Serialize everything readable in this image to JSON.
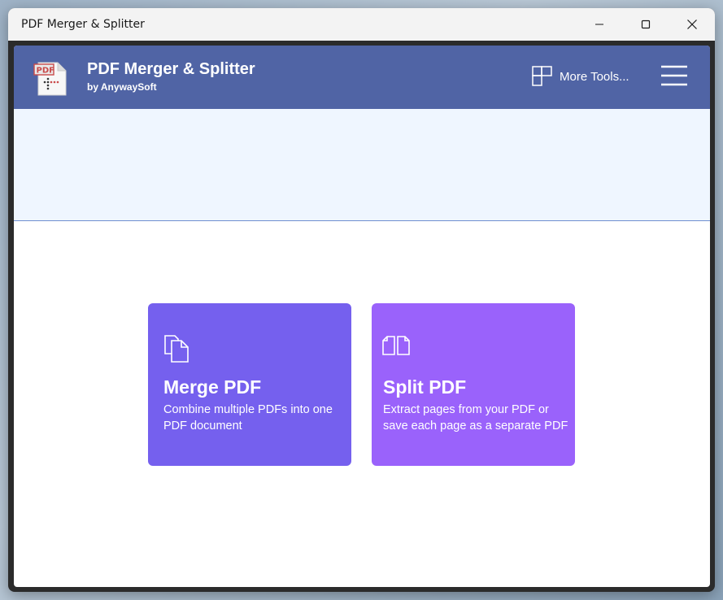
{
  "window": {
    "title": "PDF Merger & Splitter"
  },
  "header": {
    "app_title": "PDF Merger & Splitter",
    "app_subtitle": "by AnywaySoft",
    "more_tools_label": "More Tools...",
    "background_color": "#5064a5"
  },
  "cards": [
    {
      "title": "Merge PDF",
      "description": "Combine multiple PDFs into one PDF document",
      "icon": "merge-pdf-icon",
      "color": "#7560ee"
    },
    {
      "title": "Split PDF",
      "description": "Extract pages from your PDF or save each page as a separate PDF",
      "icon": "split-pdf-icon",
      "color": "#9a62fb"
    }
  ],
  "icons": {
    "logo": "pdf-file-logo-icon",
    "more_tools": "grid-tiles-icon",
    "menu": "hamburger-menu-icon",
    "minimize": "minimize-icon",
    "maximize": "maximize-icon",
    "close": "close-icon"
  }
}
